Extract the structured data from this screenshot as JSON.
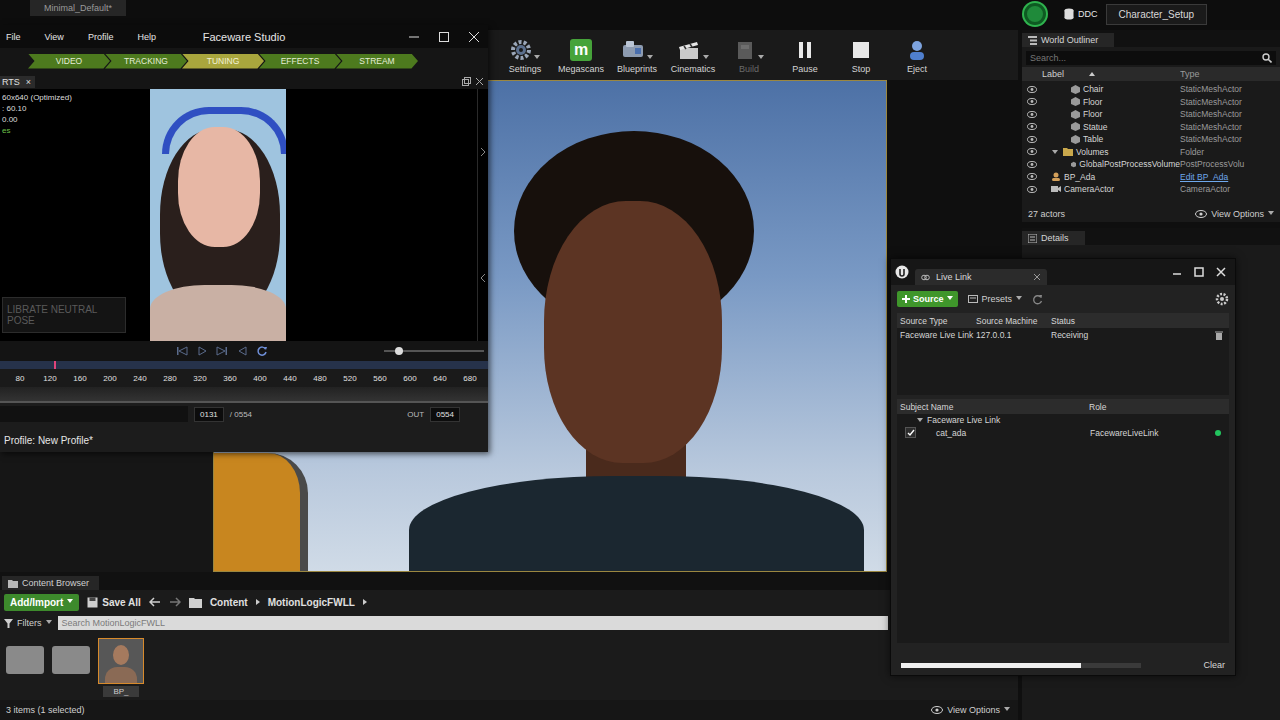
{
  "editor": {
    "tab": "Minimal_Default*",
    "ddc": "DDC",
    "project": "Character_Setup"
  },
  "toolbar": [
    {
      "label": "Settings",
      "kind": "settings",
      "dropdown": true,
      "disabled": false
    },
    {
      "label": "Megascans",
      "kind": "megascans",
      "badge": "m",
      "dropdown": false,
      "disabled": false
    },
    {
      "label": "Blueprints",
      "kind": "blueprints",
      "dropdown": true,
      "disabled": false
    },
    {
      "label": "Cinematics",
      "kind": "cinematics",
      "dropdown": true,
      "disabled": false
    },
    {
      "label": "Build",
      "kind": "build",
      "dropdown": true,
      "disabled": true
    },
    {
      "label": "Pause",
      "kind": "pause",
      "dropdown": false,
      "disabled": false
    },
    {
      "label": "Stop",
      "kind": "stop",
      "dropdown": false,
      "disabled": false
    },
    {
      "label": "Eject",
      "kind": "eject",
      "dropdown": false,
      "disabled": false
    }
  ],
  "outliner": {
    "title": "World Outliner",
    "search_placeholder": "Search...",
    "columns": [
      "Label",
      "Type"
    ],
    "rows": [
      {
        "label": "Chair",
        "type": "StaticMeshActor",
        "kind": "actor",
        "depth": 2,
        "expanded": false,
        "type_link": false,
        "visible": true
      },
      {
        "label": "Floor",
        "type": "StaticMeshActor",
        "kind": "actor",
        "depth": 2,
        "expanded": false,
        "type_link": false,
        "visible": true
      },
      {
        "label": "Floor",
        "type": "StaticMeshActor",
        "kind": "actor",
        "depth": 2,
        "expanded": false,
        "type_link": false,
        "visible": true
      },
      {
        "label": "Statue",
        "type": "StaticMeshActor",
        "kind": "actor",
        "depth": 2,
        "expanded": false,
        "type_link": false,
        "visible": true
      },
      {
        "label": "Table",
        "type": "StaticMeshActor",
        "kind": "actor",
        "depth": 2,
        "expanded": false,
        "type_link": false,
        "visible": true
      },
      {
        "label": "Volumes",
        "type": "Folder",
        "kind": "folder",
        "depth": 1,
        "expanded": true,
        "type_link": false,
        "visible": true
      },
      {
        "label": "GlobalPostProcessVolume",
        "type": "PostProcessVolu",
        "kind": "actor",
        "depth": 2,
        "expanded": false,
        "type_link": false,
        "visible": true
      },
      {
        "label": "BP_Ada",
        "type": "Edit BP_Ada",
        "kind": "blueprint",
        "depth": 0,
        "expanded": false,
        "type_link": true,
        "visible": true
      },
      {
        "label": "CameraActor",
        "type": "CameraActor",
        "kind": "camera",
        "depth": 0,
        "expanded": false,
        "type_link": false,
        "visible": true
      }
    ],
    "count": "27 actors",
    "view_options": "View Options"
  },
  "details": {
    "title": "Details"
  },
  "content_browser": {
    "title": "Content Browser",
    "add_button": "Add/Import",
    "save_button": "Save All",
    "path": [
      "Content",
      "MotionLogicFWLL"
    ],
    "filters": "Filters",
    "search_placeholder": "Search MotionLogicFWLL",
    "items": [
      {
        "kind": "folder",
        "label": "",
        "selected": false
      },
      {
        "kind": "folder",
        "label": "",
        "selected": false
      },
      {
        "kind": "asset",
        "label": "BP_",
        "selected": true
      }
    ],
    "status": "3 items (1 selected)",
    "view_options": "View Options"
  },
  "faceware": {
    "title": "Faceware Studio",
    "menus": [
      "File",
      "View",
      "Profile",
      "Help"
    ],
    "stages": [
      {
        "label": "VIDEO",
        "selected": false
      },
      {
        "label": "TRACKING",
        "selected": false
      },
      {
        "label": "TUNING",
        "selected": true
      },
      {
        "label": "EFFECTS",
        "selected": false
      },
      {
        "label": "STREAM",
        "selected": false
      }
    ],
    "panel_tab": "RTS",
    "panel_tab_close": "×",
    "info": [
      {
        "text": "60x640 (Optimized)",
        "color": "#dddddd"
      },
      {
        "text": ": 60.10",
        "color": "#dddddd"
      },
      {
        "text": "0.00",
        "color": "#dddddd"
      },
      {
        "text": "es",
        "color": "#6cc04a"
      }
    ],
    "calibrate": "LIBRATE NEUTRAL POSE",
    "zoom_level": 0.15,
    "ticks": [
      "80",
      "120",
      "160",
      "200",
      "240",
      "280",
      "320",
      "360",
      "400",
      "440",
      "480",
      "520",
      "560",
      "600",
      "640",
      "680"
    ],
    "playhead_level": 0.11,
    "frame": "0131",
    "total": "/ 0554",
    "out_label": "OUT",
    "out": "0554",
    "profile": "Profile: New Profile*"
  },
  "live_link": {
    "title": "Live Link",
    "source_button": "Source",
    "presets": "Presets",
    "source_columns": [
      "Source Type",
      "Source Machine",
      "Status"
    ],
    "sources": [
      {
        "type": "Faceware Live Link",
        "machine": "127.0.0.1",
        "status": "Receiving"
      }
    ],
    "subject_columns": [
      "Subject Name",
      "Role"
    ],
    "group": "Faceware Live Link",
    "subjects": [
      {
        "name": "cat_ada",
        "role": "FacewareLiveLink",
        "enabled": true,
        "color": "#22c55e"
      }
    ],
    "progress_level": 0.75,
    "clear": "Clear"
  }
}
